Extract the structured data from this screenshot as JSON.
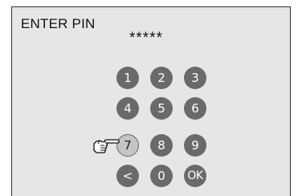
{
  "screen": {
    "title": "ENTER PIN",
    "pin_mask": "*****"
  },
  "keypad": {
    "keys": [
      "1",
      "2",
      "3",
      "4",
      "5",
      "6",
      "7",
      "8",
      "9",
      "<",
      "0",
      "OK"
    ],
    "pressed_key": "7"
  },
  "cursor": {
    "icon": "pointing-hand-icon"
  },
  "colors": {
    "panel_background": "#e6e6e6",
    "key_background": "#6a6a6a",
    "key_pressed_background": "#c4c4c4",
    "key_text": "#ffffff"
  }
}
